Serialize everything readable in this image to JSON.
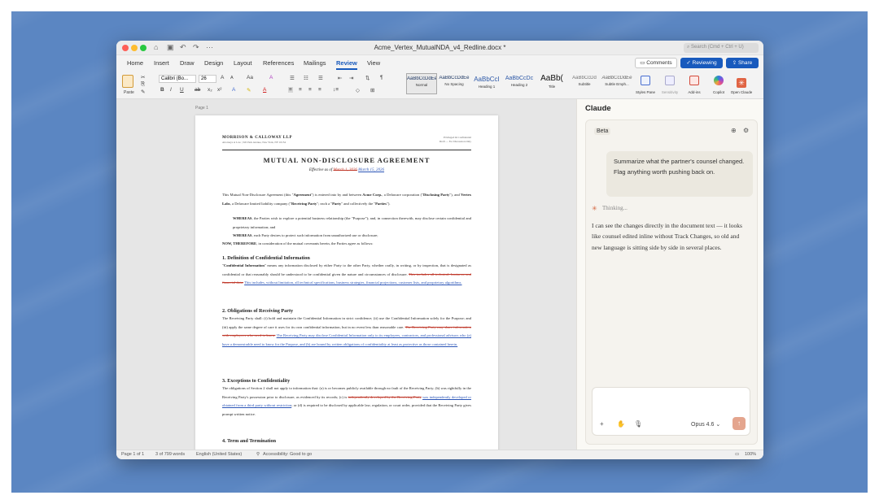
{
  "window": {
    "title": "Acme_Vertex_MutualNDA_v4_Redline.docx *",
    "search_placeholder": "Search (Cmd + Ctrl + U)"
  },
  "tabs": [
    "Home",
    "Insert",
    "Draw",
    "Design",
    "Layout",
    "References",
    "Mailings",
    "Review",
    "View"
  ],
  "active_tab": "Review",
  "header_buttons": {
    "comments": "Comments",
    "reviewing": "Reviewing",
    "share": "Share"
  },
  "ribbon": {
    "paste": "Paste",
    "font": "Calibri (Bo...",
    "size": "26",
    "styles": [
      {
        "preview": "AaBbCcDdEe",
        "name": "Normal"
      },
      {
        "preview": "AaBbCcDdEe",
        "name": "No Spacing"
      },
      {
        "preview": "AaBbCcI",
        "name": "Heading 1"
      },
      {
        "preview": "AaBbCcDc",
        "name": "Heading 2"
      },
      {
        "preview": "AaBb(",
        "name": "Title"
      },
      {
        "preview": "AaBbCcDd",
        "name": "Subtitle"
      },
      {
        "preview": "AaBbCcDdEe",
        "name": "Subtle Emph..."
      }
    ],
    "tools": [
      {
        "label": "Styles Pane"
      },
      {
        "label": "Sensitivity"
      },
      {
        "label": "Add-ins"
      },
      {
        "label": "Copilot"
      },
      {
        "label": "Open Claude"
      }
    ]
  },
  "document": {
    "page_label": "Page 1",
    "firm_name": "MORRISON & CALLOWAY LLP",
    "firm_sub": "Attorneys at Law | 345 Park Avenue, New York, NY 10154",
    "meta_line1": "Privileged & Confidential",
    "meta_line2": "Draft — For Discussion Only",
    "title": "MUTUAL NON-DISCLOSURE AGREEMENT",
    "effective_prefix": "Effective as of",
    "effective_deleted": "March 1, 2026",
    "effective_inserted": "March 15, 2026",
    "intro_a": "This Mutual Non-Disclosure Agreement (this \"",
    "intro_b": "Agreement",
    "intro_c": "\") is entered into by and between ",
    "intro_d": "Acme Corp.",
    "intro_e": ", a Delaware corporation (\"",
    "intro_f": "Disclosing Party",
    "intro_g": "\"), and ",
    "intro_h": "Vertex Labs",
    "intro_i": ", a Delaware limited liability company (\"",
    "intro_j": "Receiving Party",
    "intro_k": "\"; each a \"",
    "intro_l": "Party",
    "intro_m": "\" and collectively the \"",
    "intro_n": "Parties",
    "intro_o": "\").",
    "whereas1_label": "WHEREAS",
    "whereas1": ", the Parties wish to explore a potential business relationship (the \"Purpose\"); and, in connection therewith, may disclose certain confidential and proprietary information; and",
    "whereas2_label": "WHEREAS",
    "whereas2": ", each Party desires to protect such information from unauthorized use or disclosure;",
    "now_label": "NOW, THEREFORE",
    "now": ", in consideration of the mutual covenants herein, the Parties agree as follows:",
    "h1": "1. Definition of Confidential Information",
    "s1_label": "Confidential Information",
    "s1_text": "\" means any information disclosed by either Party to the other Party, whether orally, in writing, or by inspection, that is designated as confidential or that reasonably should be understood to be confidential given the nature and circumstances of disclosure.",
    "s1_del": "This includes all technical, business, and financial data.",
    "s1_ins": "This includes, without limitation, all technical specifications, business strategies, financial projections, customer lists, and proprietary algorithms.",
    "h2": "2. Obligations of Receiving Party",
    "s2_text": "The Receiving Party shall: (i) hold and maintain the Confidential Information in strict confidence; (ii) use the Confidential Information solely for the Purpose; and (iii) apply the same degree of care it uses for its own confidential information, but in no event less than reasonable care.",
    "s2_del": "The Receiving Party may share information with employees who need to know.",
    "s2_ins": "The Receiving Party may disclose Confidential Information only to its employees, contractors, and professional advisors who (a) have a demonstrable need to know for the Purpose, and (b) are bound by written obligations of confidentiality at least as protective as those contained herein.",
    "h3": "3. Exceptions to Confidentiality",
    "s3_text": "The obligations of Section 2 shall not apply to information that: (a) is or becomes publicly available through no fault of the Receiving Party; (b) was rightfully in the Receiving Party's possession prior to disclosure, as evidenced by its records; (c) is",
    "s3_del": "independently developed by the Receiving Party",
    "s3_ins": "was independently developed or obtained from a third party without restriction",
    "s3_tail": "; or (d) is required to be disclosed by applicable law, regulation, or court order, provided that the Receiving Party gives prompt written notice.",
    "h4": "4. Term and Termination"
  },
  "statusbar": {
    "page": "Page 1 of 1",
    "words": "3 of 799 words",
    "language": "English (United States)",
    "accessibility": "Accessibility: Good to go",
    "zoom": "100%"
  },
  "claude": {
    "title": "Claude",
    "beta": "Beta",
    "user_message": "Summarize what the partner's counsel changed. Flag anything worth pushing back on.",
    "thinking": "Thinking...",
    "response": "I can see the changes directly in the document text — it looks like counsel edited inline without Track Changes, so old and new language is sitting side by side in several places.",
    "model": "Opus 4.6"
  }
}
